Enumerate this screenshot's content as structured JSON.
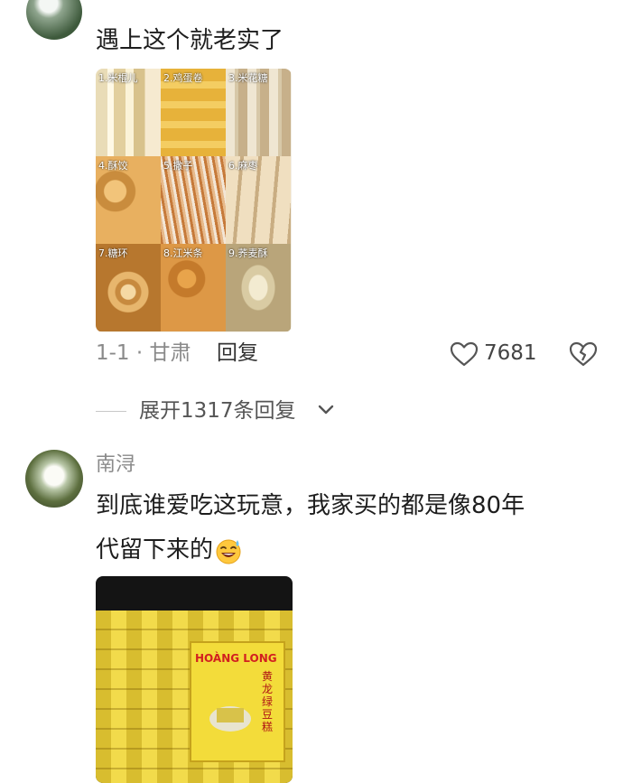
{
  "comment_1": {
    "text": "遇上这个就老实了",
    "grid_labels": [
      "1.米棍儿",
      "2.鸡蛋卷",
      "3.米花糖",
      "4.酥饺",
      "5.撒子",
      "6.麻枣",
      "7.糖环",
      "8.江米条",
      "9.荞麦酥"
    ],
    "meta": "1-1 · 甘肃",
    "reply_label": "回复",
    "likes": "7681"
  },
  "expand": {
    "label": "展开1317条回复"
  },
  "comment_2": {
    "username": "南浔",
    "line1": "到底谁爱吃这玩意，我家买的都是像80年",
    "line2": "代留下来的",
    "emoji": "sweat-smile-emoji",
    "photo_brand": "HOÀNG LONG",
    "photo_product": "黄龙绿豆糕"
  },
  "colors": {
    "muted": "#8a8a8a",
    "text": "#1d1d1d",
    "icon": "#555555"
  }
}
